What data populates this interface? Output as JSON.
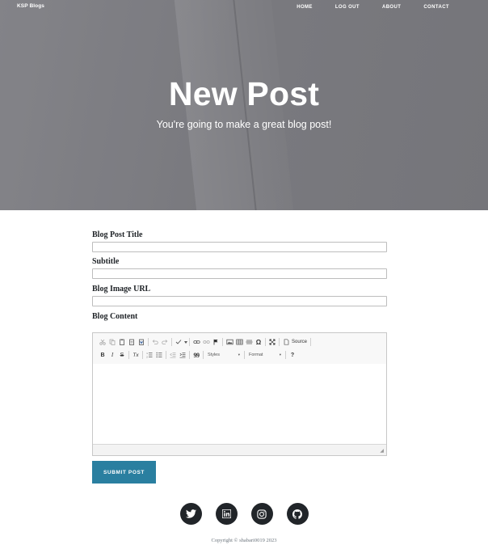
{
  "header": {
    "brand": "KSP Blogs",
    "nav": [
      "HOME",
      "LOG OUT",
      "ABOUT",
      "CONTACT"
    ],
    "title": "New Post",
    "subtitle": "You're going to make a great blog post!"
  },
  "form": {
    "title_label": "Blog Post Title",
    "title_value": "",
    "subtitle_label": "Subtitle",
    "subtitle_value": "",
    "image_label": "Blog Image URL",
    "image_value": "",
    "content_label": "Blog Content",
    "toolbar": {
      "source_label": "Source",
      "styles_label": "Styles",
      "format_label": "Format",
      "bold_label": "B",
      "italic_label": "I",
      "strike_label": "S",
      "clear_label": "Tx",
      "quote_label": "99",
      "help_label": "?",
      "omega_label": "Ω"
    },
    "submit_label": "SUBMIT POST"
  },
  "footer": {
    "social": [
      "twitter",
      "linkedin",
      "instagram",
      "github"
    ],
    "copyright": "Copyright © shabari0019 2023"
  },
  "colors": {
    "accent": "#2a7fa0",
    "footer_icon_bg": "#212529"
  }
}
